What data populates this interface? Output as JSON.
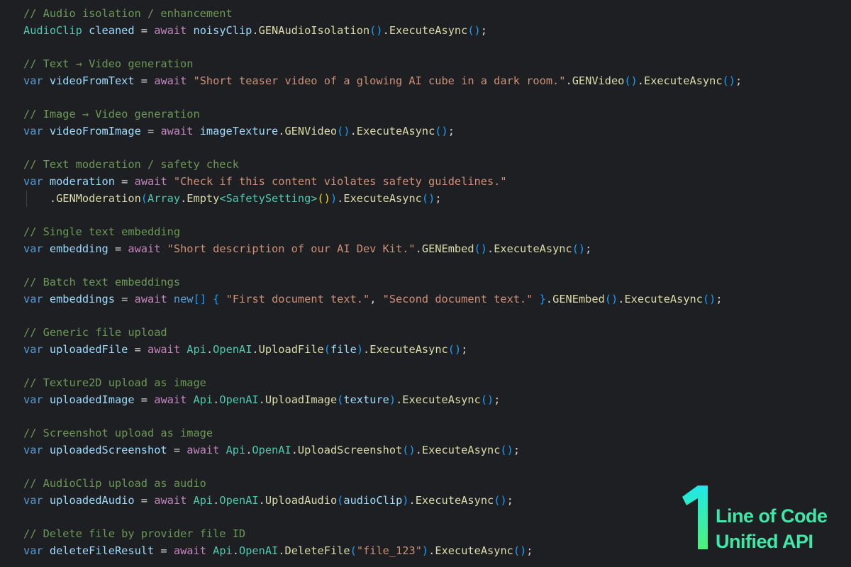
{
  "editor": {
    "theme": {
      "background": "#1e1f22",
      "comment": "#6a9955",
      "keyword": "#569cd6",
      "control": "#c586c0",
      "type": "#4ec9b0",
      "identifier": "#9cdcfe",
      "string": "#ce9178",
      "function": "#dcdcaa",
      "plain": "#d4d4d4"
    },
    "lines": [
      {
        "tokens": [
          {
            "t": "cm",
            "v": "// Audio isolation / enhancement"
          }
        ]
      },
      {
        "tokens": [
          {
            "t": "ty",
            "v": "AudioClip"
          },
          {
            "t": "pl",
            "v": " "
          },
          {
            "t": "id",
            "v": "cleaned"
          },
          {
            "t": "pl",
            "v": " = "
          },
          {
            "t": "aw",
            "v": "await"
          },
          {
            "t": "pl",
            "v": " "
          },
          {
            "t": "id",
            "v": "noisyClip"
          },
          {
            "t": "pl",
            "v": "."
          },
          {
            "t": "fn",
            "v": "GENAudioIsolation"
          },
          {
            "t": "br3",
            "v": "()"
          },
          {
            "t": "pl",
            "v": "."
          },
          {
            "t": "fn",
            "v": "ExecuteAsync"
          },
          {
            "t": "br3",
            "v": "()"
          },
          {
            "t": "pl",
            "v": ";"
          }
        ]
      },
      {
        "tokens": []
      },
      {
        "tokens": [
          {
            "t": "cm",
            "v": "// Text → Video generation"
          }
        ]
      },
      {
        "tokens": [
          {
            "t": "kw",
            "v": "var"
          },
          {
            "t": "pl",
            "v": " "
          },
          {
            "t": "id",
            "v": "videoFromText"
          },
          {
            "t": "pl",
            "v": " = "
          },
          {
            "t": "aw",
            "v": "await"
          },
          {
            "t": "pl",
            "v": " "
          },
          {
            "t": "st",
            "v": "\"Short teaser video of a glowing AI cube in a dark room.\""
          },
          {
            "t": "pl",
            "v": "."
          },
          {
            "t": "fn",
            "v": "GENVideo"
          },
          {
            "t": "br3",
            "v": "()"
          },
          {
            "t": "pl",
            "v": "."
          },
          {
            "t": "fn",
            "v": "ExecuteAsync"
          },
          {
            "t": "br3",
            "v": "()"
          },
          {
            "t": "pl",
            "v": ";"
          }
        ]
      },
      {
        "tokens": []
      },
      {
        "tokens": [
          {
            "t": "cm",
            "v": "// Image → Video generation"
          }
        ]
      },
      {
        "tokens": [
          {
            "t": "kw",
            "v": "var"
          },
          {
            "t": "pl",
            "v": " "
          },
          {
            "t": "id",
            "v": "videoFromImage"
          },
          {
            "t": "pl",
            "v": " = "
          },
          {
            "t": "aw",
            "v": "await"
          },
          {
            "t": "pl",
            "v": " "
          },
          {
            "t": "id",
            "v": "imageTexture"
          },
          {
            "t": "pl",
            "v": "."
          },
          {
            "t": "fn",
            "v": "GENVideo"
          },
          {
            "t": "br3",
            "v": "()"
          },
          {
            "t": "pl",
            "v": "."
          },
          {
            "t": "fn",
            "v": "ExecuteAsync"
          },
          {
            "t": "br3",
            "v": "()"
          },
          {
            "t": "pl",
            "v": ";"
          }
        ]
      },
      {
        "tokens": []
      },
      {
        "tokens": [
          {
            "t": "cm",
            "v": "// Text moderation / safety check"
          }
        ]
      },
      {
        "tokens": [
          {
            "t": "kw",
            "v": "var"
          },
          {
            "t": "pl",
            "v": " "
          },
          {
            "t": "id",
            "v": "moderation"
          },
          {
            "t": "pl",
            "v": " = "
          },
          {
            "t": "aw",
            "v": "await"
          },
          {
            "t": "pl",
            "v": " "
          },
          {
            "t": "st",
            "v": "\"Check if this content violates safety guidelines.\""
          }
        ]
      },
      {
        "indent": true,
        "tokens": [
          {
            "t": "pl",
            "v": "    ."
          },
          {
            "t": "fn",
            "v": "GENModeration"
          },
          {
            "t": "br3",
            "v": "("
          },
          {
            "t": "ty",
            "v": "Array"
          },
          {
            "t": "pl",
            "v": "."
          },
          {
            "t": "fn",
            "v": "Empty"
          },
          {
            "t": "ty",
            "v": "<SafetySetting>"
          },
          {
            "t": "br1",
            "v": "()"
          },
          {
            "t": "br3",
            "v": ")"
          },
          {
            "t": "pl",
            "v": "."
          },
          {
            "t": "fn",
            "v": "ExecuteAsync"
          },
          {
            "t": "br3",
            "v": "()"
          },
          {
            "t": "pl",
            "v": ";"
          }
        ]
      },
      {
        "tokens": []
      },
      {
        "tokens": [
          {
            "t": "cm",
            "v": "// Single text embedding"
          }
        ]
      },
      {
        "tokens": [
          {
            "t": "kw",
            "v": "var"
          },
          {
            "t": "pl",
            "v": " "
          },
          {
            "t": "id",
            "v": "embedding"
          },
          {
            "t": "pl",
            "v": " = "
          },
          {
            "t": "aw",
            "v": "await"
          },
          {
            "t": "pl",
            "v": " "
          },
          {
            "t": "st",
            "v": "\"Short description of our AI Dev Kit.\""
          },
          {
            "t": "pl",
            "v": "."
          },
          {
            "t": "fn",
            "v": "GENEmbed"
          },
          {
            "t": "br3",
            "v": "()"
          },
          {
            "t": "pl",
            "v": "."
          },
          {
            "t": "fn",
            "v": "ExecuteAsync"
          },
          {
            "t": "br3",
            "v": "()"
          },
          {
            "t": "pl",
            "v": ";"
          }
        ]
      },
      {
        "tokens": []
      },
      {
        "tokens": [
          {
            "t": "cm",
            "v": "// Batch text embeddings"
          }
        ]
      },
      {
        "tokens": [
          {
            "t": "kw",
            "v": "var"
          },
          {
            "t": "pl",
            "v": " "
          },
          {
            "t": "id",
            "v": "embeddings"
          },
          {
            "t": "pl",
            "v": " = "
          },
          {
            "t": "aw",
            "v": "await"
          },
          {
            "t": "pl",
            "v": " "
          },
          {
            "t": "kw",
            "v": "new"
          },
          {
            "t": "br3",
            "v": "[]"
          },
          {
            "t": "pl",
            "v": " "
          },
          {
            "t": "br3",
            "v": "{"
          },
          {
            "t": "pl",
            "v": " "
          },
          {
            "t": "st",
            "v": "\"First document text.\""
          },
          {
            "t": "pl",
            "v": ", "
          },
          {
            "t": "st",
            "v": "\"Second document text.\""
          },
          {
            "t": "pl",
            "v": " "
          },
          {
            "t": "br3",
            "v": "}"
          },
          {
            "t": "pl",
            "v": "."
          },
          {
            "t": "fn",
            "v": "GENEmbed"
          },
          {
            "t": "br3",
            "v": "()"
          },
          {
            "t": "pl",
            "v": "."
          },
          {
            "t": "fn",
            "v": "ExecuteAsync"
          },
          {
            "t": "br3",
            "v": "()"
          },
          {
            "t": "pl",
            "v": ";"
          }
        ]
      },
      {
        "tokens": []
      },
      {
        "tokens": [
          {
            "t": "cm",
            "v": "// Generic file upload"
          }
        ]
      },
      {
        "tokens": [
          {
            "t": "kw",
            "v": "var"
          },
          {
            "t": "pl",
            "v": " "
          },
          {
            "t": "id",
            "v": "uploadedFile"
          },
          {
            "t": "pl",
            "v": " = "
          },
          {
            "t": "aw",
            "v": "await"
          },
          {
            "t": "pl",
            "v": " "
          },
          {
            "t": "ty",
            "v": "Api"
          },
          {
            "t": "pl",
            "v": "."
          },
          {
            "t": "ty",
            "v": "OpenAI"
          },
          {
            "t": "pl",
            "v": "."
          },
          {
            "t": "fn",
            "v": "UploadFile"
          },
          {
            "t": "br3",
            "v": "("
          },
          {
            "t": "id",
            "v": "file"
          },
          {
            "t": "br3",
            "v": ")"
          },
          {
            "t": "pl",
            "v": "."
          },
          {
            "t": "fn",
            "v": "ExecuteAsync"
          },
          {
            "t": "br3",
            "v": "()"
          },
          {
            "t": "pl",
            "v": ";"
          }
        ]
      },
      {
        "tokens": []
      },
      {
        "tokens": [
          {
            "t": "cm",
            "v": "// Texture2D upload as image"
          }
        ]
      },
      {
        "tokens": [
          {
            "t": "kw",
            "v": "var"
          },
          {
            "t": "pl",
            "v": " "
          },
          {
            "t": "id",
            "v": "uploadedImage"
          },
          {
            "t": "pl",
            "v": " = "
          },
          {
            "t": "aw",
            "v": "await"
          },
          {
            "t": "pl",
            "v": " "
          },
          {
            "t": "ty",
            "v": "Api"
          },
          {
            "t": "pl",
            "v": "."
          },
          {
            "t": "ty",
            "v": "OpenAI"
          },
          {
            "t": "pl",
            "v": "."
          },
          {
            "t": "fn",
            "v": "UploadImage"
          },
          {
            "t": "br3",
            "v": "("
          },
          {
            "t": "id",
            "v": "texture"
          },
          {
            "t": "br3",
            "v": ")"
          },
          {
            "t": "pl",
            "v": "."
          },
          {
            "t": "fn",
            "v": "ExecuteAsync"
          },
          {
            "t": "br3",
            "v": "()"
          },
          {
            "t": "pl",
            "v": ";"
          }
        ]
      },
      {
        "tokens": []
      },
      {
        "tokens": [
          {
            "t": "cm",
            "v": "// Screenshot upload as image"
          }
        ]
      },
      {
        "tokens": [
          {
            "t": "kw",
            "v": "var"
          },
          {
            "t": "pl",
            "v": " "
          },
          {
            "t": "id",
            "v": "uploadedScreenshot"
          },
          {
            "t": "pl",
            "v": " = "
          },
          {
            "t": "aw",
            "v": "await"
          },
          {
            "t": "pl",
            "v": " "
          },
          {
            "t": "ty",
            "v": "Api"
          },
          {
            "t": "pl",
            "v": "."
          },
          {
            "t": "ty",
            "v": "OpenAI"
          },
          {
            "t": "pl",
            "v": "."
          },
          {
            "t": "fn",
            "v": "UploadScreenshot"
          },
          {
            "t": "br3",
            "v": "()"
          },
          {
            "t": "pl",
            "v": "."
          },
          {
            "t": "fn",
            "v": "ExecuteAsync"
          },
          {
            "t": "br3",
            "v": "()"
          },
          {
            "t": "pl",
            "v": ";"
          }
        ]
      },
      {
        "tokens": []
      },
      {
        "tokens": [
          {
            "t": "cm",
            "v": "// AudioClip upload as audio"
          }
        ]
      },
      {
        "tokens": [
          {
            "t": "kw",
            "v": "var"
          },
          {
            "t": "pl",
            "v": " "
          },
          {
            "t": "id",
            "v": "uploadedAudio"
          },
          {
            "t": "pl",
            "v": " = "
          },
          {
            "t": "aw",
            "v": "await"
          },
          {
            "t": "pl",
            "v": " "
          },
          {
            "t": "ty",
            "v": "Api"
          },
          {
            "t": "pl",
            "v": "."
          },
          {
            "t": "ty",
            "v": "OpenAI"
          },
          {
            "t": "pl",
            "v": "."
          },
          {
            "t": "fn",
            "v": "UploadAudio"
          },
          {
            "t": "br3",
            "v": "("
          },
          {
            "t": "id",
            "v": "audioClip"
          },
          {
            "t": "br3",
            "v": ")"
          },
          {
            "t": "pl",
            "v": "."
          },
          {
            "t": "fn",
            "v": "ExecuteAsync"
          },
          {
            "t": "br3",
            "v": "()"
          },
          {
            "t": "pl",
            "v": ";"
          }
        ]
      },
      {
        "tokens": []
      },
      {
        "tokens": [
          {
            "t": "cm",
            "v": "// Delete file by provider file ID"
          }
        ]
      },
      {
        "tokens": [
          {
            "t": "kw",
            "v": "var"
          },
          {
            "t": "pl",
            "v": " "
          },
          {
            "t": "id",
            "v": "deleteFileResult"
          },
          {
            "t": "pl",
            "v": " = "
          },
          {
            "t": "aw",
            "v": "await"
          },
          {
            "t": "pl",
            "v": " "
          },
          {
            "t": "ty",
            "v": "Api"
          },
          {
            "t": "pl",
            "v": "."
          },
          {
            "t": "ty",
            "v": "OpenAI"
          },
          {
            "t": "pl",
            "v": "."
          },
          {
            "t": "fn",
            "v": "DeleteFile"
          },
          {
            "t": "br3",
            "v": "("
          },
          {
            "t": "st",
            "v": "\"file_123\""
          },
          {
            "t": "br3",
            "v": ")"
          },
          {
            "t": "pl",
            "v": "."
          },
          {
            "t": "fn",
            "v": "ExecuteAsync"
          },
          {
            "t": "br3",
            "v": "()"
          },
          {
            "t": "pl",
            "v": ";"
          }
        ]
      }
    ]
  },
  "brand": {
    "number": "1",
    "line1": "Line of Code",
    "line2": "Unified API",
    "color_top": "#1ee8e8",
    "color_bottom": "#4ef07a",
    "text_color": "#3ee8a8"
  }
}
